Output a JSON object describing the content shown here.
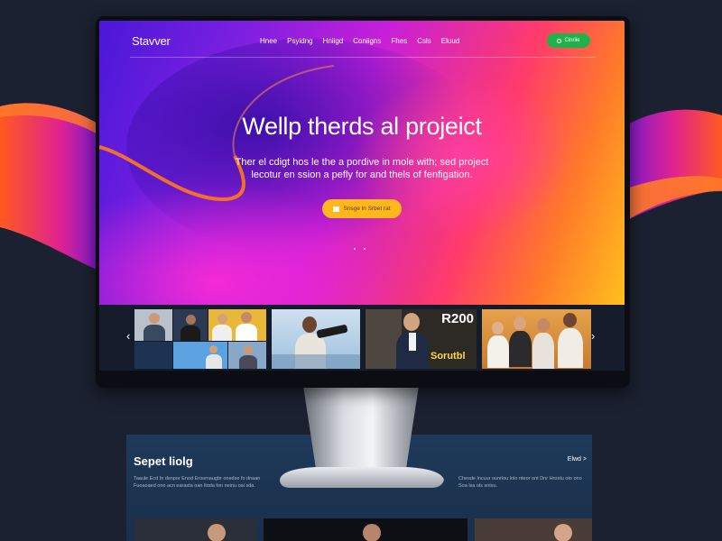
{
  "site": {
    "logo": "Stavver"
  },
  "nav": {
    "links": [
      "Hnee",
      "Psyidng",
      "Hniigd",
      "Coniigns",
      "Fhes",
      "Csls",
      "Eluud"
    ],
    "cta_label": "Cinrile"
  },
  "hero": {
    "title": "Wellp therds al projeict",
    "subtitle": "Ther el cdigt hos le the a pordive in mole with; sed project lecotur en ssion a pefly for and thels of fenfigation.",
    "cta_label": "Snsge ln Srbet rat"
  },
  "gallery": {
    "prev_label": "‹",
    "next_label": "›",
    "sign_text": "R200",
    "neon_text": "Sorutbl"
  },
  "background_page": {
    "section_title": "Sepet liolg",
    "link_label": "Elwd >",
    "desc_left": "Taaule Ecd In dsnpor Enod Eroomaugbr onedse fo dnaan Fuoaoaed ono acn earasta oan ltoda fon neinu oai sda.",
    "desc_right": "Chesde lncuur ounrlou lolo nteor ont Dnr Hronlu oto ono Soa lsa ols sotsu."
  },
  "colors": {
    "page_bg": "#1b2130",
    "cta_green": "#1fb24a",
    "cta_yellow": "#ffb81c",
    "gallery_bg": "#141c2c"
  }
}
